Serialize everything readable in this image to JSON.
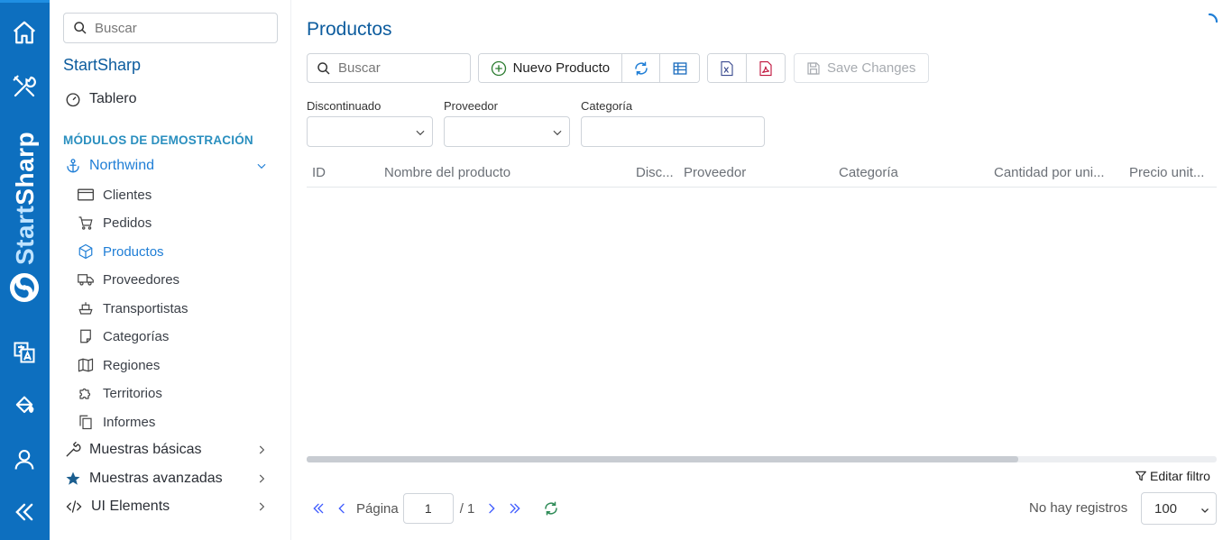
{
  "rail": {
    "brand_part1": "Start",
    "brand_part2": "Sharp",
    "icons": [
      "home-icon",
      "tools-icon",
      "logo-icon",
      "translate-icon",
      "paint-bucket-icon",
      "user-icon",
      "collapse-icon"
    ]
  },
  "sidebar": {
    "search_placeholder": "Buscar",
    "title": "StartSharp",
    "dashboard": "Tablero",
    "section": "MÓDULOS DE DEMOSTRACIÓN",
    "northwind": "Northwind",
    "sub_items": [
      {
        "label": "Clientes",
        "icon": "card-icon"
      },
      {
        "label": "Pedidos",
        "icon": "cart-icon"
      },
      {
        "label": "Productos",
        "icon": "box-icon"
      },
      {
        "label": "Proveedores",
        "icon": "truck-icon"
      },
      {
        "label": "Transportistas",
        "icon": "ship-icon"
      },
      {
        "label": "Categorías",
        "icon": "note-icon"
      },
      {
        "label": "Regiones",
        "icon": "map-icon"
      },
      {
        "label": "Territorios",
        "icon": "puzzle-icon"
      },
      {
        "label": "Informes",
        "icon": "copy-icon"
      }
    ],
    "basic_samples": "Muestras básicas",
    "advanced_samples": "Muestras avanzadas",
    "ui_elements": "UI Elements"
  },
  "main": {
    "title": "Productos",
    "search_placeholder": "Buscar",
    "new_product": "Nuevo Producto",
    "save_changes": "Save Changes",
    "filters": {
      "discontinued": "Discontinuado",
      "supplier": "Proveedor",
      "category": "Categoría"
    },
    "columns": [
      "ID",
      "Nombre del producto",
      "Disc...",
      "Proveedor",
      "Categoría",
      "Cantidad por uni...",
      "Precio unit..."
    ],
    "edit_filter": "Editar filtro",
    "pager": {
      "page_label": "Página",
      "current_page": "1",
      "total": "/ 1",
      "no_records": "No hay registros",
      "page_size": "100"
    }
  },
  "colors": {
    "rail": "#0d6fbf",
    "title": "#0d5c9e",
    "active": "#1f7ed6",
    "section": "#2a8fbf"
  }
}
